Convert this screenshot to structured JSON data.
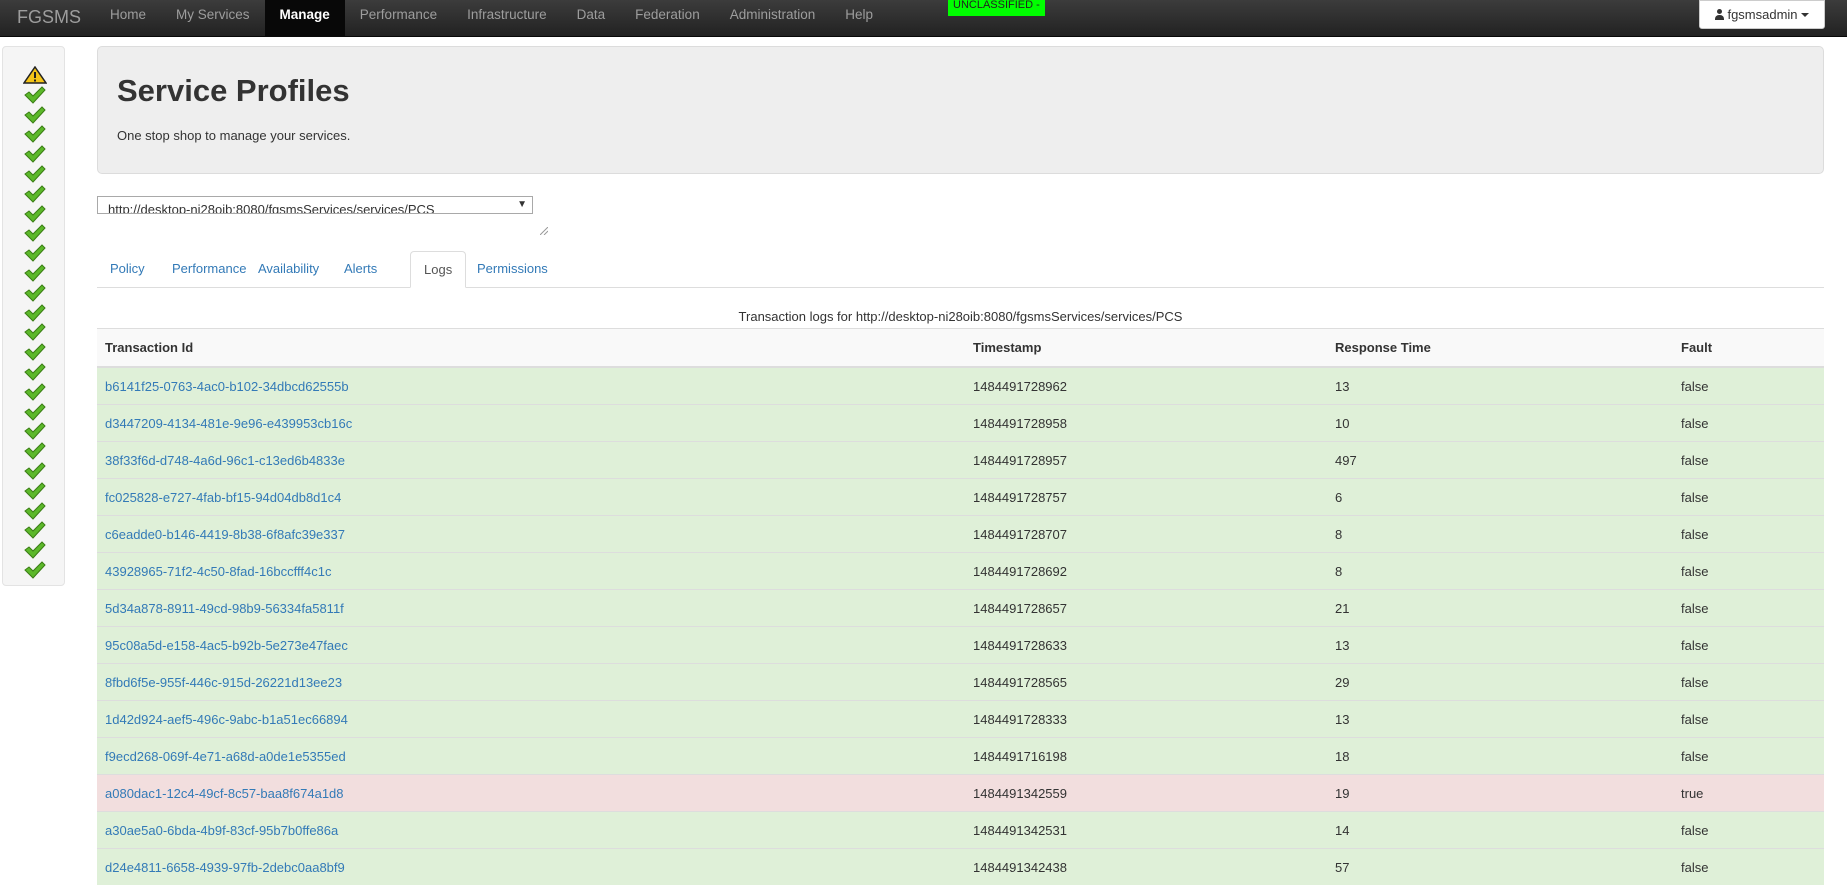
{
  "navbar": {
    "brand": "FGSMS",
    "items": [
      {
        "label": "Home"
      },
      {
        "label": "My Services"
      },
      {
        "label": "Manage"
      },
      {
        "label": "Performance"
      },
      {
        "label": "Infrastructure"
      },
      {
        "label": "Data"
      },
      {
        "label": "Federation"
      },
      {
        "label": "Administration"
      },
      {
        "label": "Help"
      }
    ],
    "active_item": "Manage",
    "classification": "UNCLASSIFIED -",
    "user": "fgsmsadmin"
  },
  "status_panel": {
    "icons": [
      "warning-icon",
      "check-icon",
      "check-icon",
      "check-icon",
      "check-icon",
      "check-icon",
      "check-icon",
      "check-icon",
      "check-icon",
      "check-icon",
      "check-icon",
      "check-icon",
      "check-icon",
      "check-icon",
      "check-icon",
      "check-icon",
      "check-icon",
      "check-icon",
      "check-icon",
      "check-icon",
      "check-icon",
      "check-icon",
      "check-icon",
      "check-icon",
      "check-icon",
      "check-icon"
    ]
  },
  "jumbotron": {
    "title": "Service Profiles",
    "subtitle": "One stop shop to manage your services."
  },
  "service_select": {
    "value": "http://desktop-ni28oib:8080/fgsmsServices/services/PCS"
  },
  "tabs": [
    {
      "label": "Policy"
    },
    {
      "label": "Performance"
    },
    {
      "label": "Availability"
    },
    {
      "label": "Alerts"
    },
    {
      "label": "Logs"
    },
    {
      "label": "Permissions"
    }
  ],
  "active_tab": "Logs",
  "logs": {
    "caption": "Transaction logs for http://desktop-ni28oib:8080/fgsmsServices/services/PCS",
    "columns": [
      "Transaction Id",
      "Timestamp",
      "Response Time",
      "Fault"
    ],
    "rows": [
      {
        "id": "b6141f25-0763-4ac0-b102-34dbcd62555b",
        "timestamp": "1484491728962",
        "response_time": "13",
        "fault": "false"
      },
      {
        "id": "d3447209-4134-481e-9e96-e439953cb16c",
        "timestamp": "1484491728958",
        "response_time": "10",
        "fault": "false"
      },
      {
        "id": "38f33f6d-d748-4a6d-96c1-c13ed6b4833e",
        "timestamp": "1484491728957",
        "response_time": "497",
        "fault": "false"
      },
      {
        "id": "fc025828-e727-4fab-bf15-94d04db8d1c4",
        "timestamp": "1484491728757",
        "response_time": "6",
        "fault": "false"
      },
      {
        "id": "c6eadde0-b146-4419-8b38-6f8afc39e337",
        "timestamp": "1484491728707",
        "response_time": "8",
        "fault": "false"
      },
      {
        "id": "43928965-71f2-4c50-8fad-16bccfff4c1c",
        "timestamp": "1484491728692",
        "response_time": "8",
        "fault": "false"
      },
      {
        "id": "5d34a878-8911-49cd-98b9-56334fa5811f",
        "timestamp": "1484491728657",
        "response_time": "21",
        "fault": "false"
      },
      {
        "id": "95c08a5d-e158-4ac5-b92b-5e273e47faec",
        "timestamp": "1484491728633",
        "response_time": "13",
        "fault": "false"
      },
      {
        "id": "8fbd6f5e-955f-446c-915d-26221d13ee23",
        "timestamp": "1484491728565",
        "response_time": "29",
        "fault": "false"
      },
      {
        "id": "1d42d924-aef5-496c-9abc-b1a51ec66894",
        "timestamp": "1484491728333",
        "response_time": "13",
        "fault": "false"
      },
      {
        "id": "f9ecd268-069f-4e71-a68d-a0de1e5355ed",
        "timestamp": "1484491716198",
        "response_time": "18",
        "fault": "false"
      },
      {
        "id": "a080dac1-12c4-49cf-8c57-baa8f674a1d8",
        "timestamp": "1484491342559",
        "response_time": "19",
        "fault": "true"
      },
      {
        "id": "a30ae5a0-6bda-4b9f-83cf-95b7b0ffe86a",
        "timestamp": "1484491342531",
        "response_time": "14",
        "fault": "false"
      },
      {
        "id": "d24e4811-6658-4939-97fb-2debc0aa8bf9",
        "timestamp": "1484491342438",
        "response_time": "57",
        "fault": "false"
      }
    ]
  },
  "colors": {
    "ok_row": "#dff0d8",
    "fault_row": "#f2dede",
    "link": "#337ab7",
    "classification_bg": "#00ff00"
  }
}
